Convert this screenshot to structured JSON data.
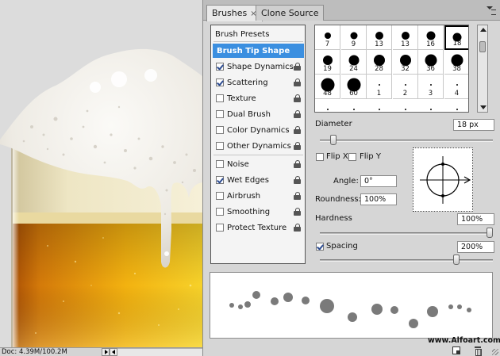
{
  "status_bar": {
    "doc_info": "Doc: 4.39M/100.2M"
  },
  "panel": {
    "tabs": [
      {
        "label": "Brushes",
        "close": "×",
        "active": true
      },
      {
        "label": "Clone Source",
        "active": false
      }
    ],
    "options": [
      {
        "label": "Brush Presets",
        "type": "header"
      },
      {
        "label": "Brush Tip Shape",
        "type": "selected"
      },
      {
        "label": "Shape Dynamics",
        "checked": true,
        "lock": true
      },
      {
        "label": "Scattering",
        "checked": true,
        "lock": true
      },
      {
        "label": "Texture",
        "checked": false,
        "lock": true
      },
      {
        "label": "Dual Brush",
        "checked": false,
        "lock": true
      },
      {
        "label": "Color Dynamics",
        "checked": false,
        "lock": true
      },
      {
        "label": "Other Dynamics",
        "checked": false,
        "lock": true
      },
      {
        "label": "Noise",
        "checked": false,
        "lock": true
      },
      {
        "label": "Wet Edges",
        "checked": true,
        "lock": true
      },
      {
        "label": "Airbrush",
        "checked": false,
        "lock": true
      },
      {
        "label": "Smoothing",
        "checked": false,
        "lock": true
      },
      {
        "label": "Protect Texture",
        "checked": false,
        "lock": true
      }
    ],
    "brush_tips": [
      {
        "size": "7"
      },
      {
        "size": "9"
      },
      {
        "size": "13"
      },
      {
        "size": "13"
      },
      {
        "size": "16"
      },
      {
        "size": "18",
        "selected": true
      },
      {
        "size": "19"
      },
      {
        "size": "24"
      },
      {
        "size": "28"
      },
      {
        "size": "32"
      },
      {
        "size": "36"
      },
      {
        "size": "38"
      },
      {
        "size": "48"
      },
      {
        "size": "60"
      },
      {
        "size": "1"
      },
      {
        "size": "2"
      },
      {
        "size": "3"
      },
      {
        "size": "4"
      }
    ],
    "diameter": {
      "label": "Diameter",
      "value": "18 px",
      "slider_fraction": 0.06
    },
    "flip_x": {
      "label": "Flip X",
      "checked": false
    },
    "flip_y": {
      "label": "Flip Y",
      "checked": false
    },
    "angle": {
      "label": "Angle:",
      "value": "0°"
    },
    "roundness": {
      "label": "Roundness:",
      "value": "100%"
    },
    "hardness": {
      "label": "Hardness",
      "value": "100%",
      "slider_fraction": 1.0
    },
    "spacing": {
      "label": "Spacing",
      "checked": true,
      "value": "200%",
      "slider_fraction": 0.8
    }
  },
  "watermark": "www.Alfoart.com"
}
